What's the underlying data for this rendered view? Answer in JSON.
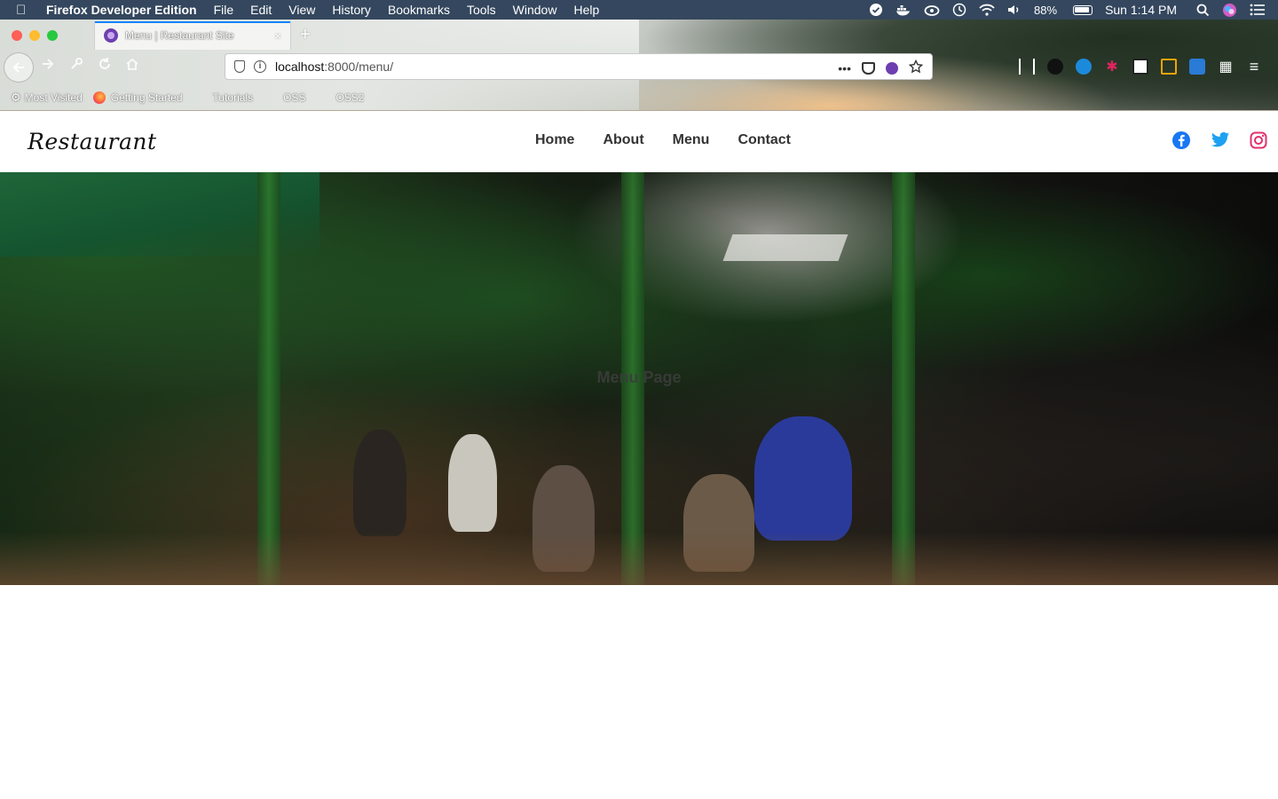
{
  "menubar": {
    "app_name": "Firefox Developer Edition",
    "items": [
      "File",
      "Edit",
      "View",
      "History",
      "Bookmarks",
      "Tools",
      "Window",
      "Help"
    ],
    "battery": "88%",
    "time": "Sun 1:14 PM"
  },
  "browser": {
    "tab_title": "Menu | Restaurant Site",
    "tab_close": "×",
    "new_tab": "+",
    "url_host": "localhost",
    "url_path": ":8000/menu/",
    "page_actions": "•••",
    "bookmarks": [
      "Most Visited",
      "Getting Started",
      "Tutorials",
      "OSS",
      "OSS2"
    ]
  },
  "site": {
    "brand": "Restaurant",
    "nav": [
      "Home",
      "About",
      "Menu",
      "Contact"
    ],
    "social": [
      "facebook-icon",
      "twitter-icon",
      "instagram-icon"
    ],
    "hero_title": "Menu Page"
  },
  "colors": {
    "menubar_bg": "#34475e",
    "facebook": "#1877f2",
    "twitter": "#1da1f2",
    "instagram": "#e1306c",
    "tab_accent": "#0a84ff"
  }
}
